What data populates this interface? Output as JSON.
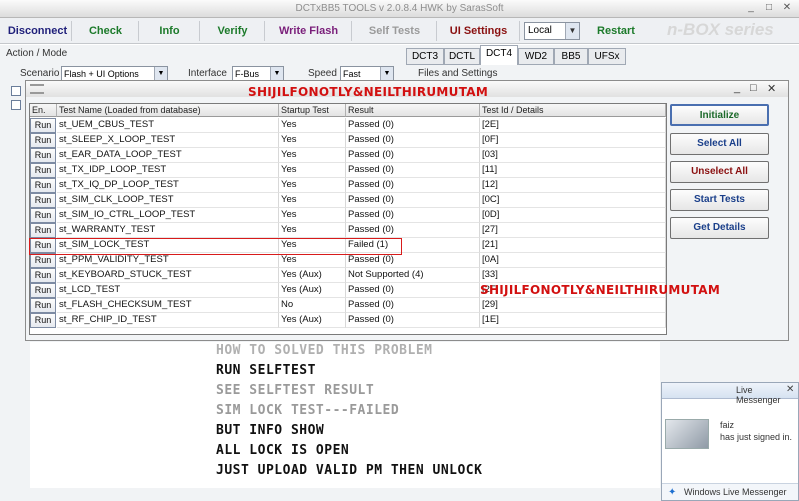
{
  "app": {
    "title": "DCTxBB5 TOOLS v 2.0.8.4 HWK by SarasSoft",
    "brand": "n-BOX series"
  },
  "toolbar": {
    "buttons": [
      {
        "label": "Disconnect",
        "color": "#1f1f7a"
      },
      {
        "label": "Check",
        "color": "#1c7a2a"
      },
      {
        "label": "Info",
        "color": "#1c7a2a"
      },
      {
        "label": "Verify",
        "color": "#1c7a2a"
      },
      {
        "label": "Write Flash",
        "color": "#7a1f7a"
      },
      {
        "label": "Self Tests",
        "color": "#9a9a9a"
      },
      {
        "label": "UI Settings",
        "color": "#8a1010"
      }
    ],
    "local_select": "Local",
    "restart_label": "Restart"
  },
  "action": {
    "group_label": "Action / Mode",
    "scenario_label": "Scenario",
    "scenario_value": "Flash + UI Options",
    "interface_label": "Interface",
    "interface_value": "F-Bus",
    "speed_label": "Speed",
    "speed_value": "Fast",
    "files_label": "Files and Settings"
  },
  "tabs": [
    "DCT3",
    "DCTL",
    "DCT4",
    "WD2",
    "BB5",
    "UFSx"
  ],
  "grid": {
    "headers": [
      "En.",
      "Test Name (Loaded from database)",
      "Startup Test",
      "Result",
      "Test Id / Details"
    ],
    "run_label": "Run",
    "rows": [
      {
        "name": "st_UEM_CBUS_TEST",
        "startup": "Yes",
        "result": "Passed (0)",
        "id": "[2E]"
      },
      {
        "name": "st_SLEEP_X_LOOP_TEST",
        "startup": "Yes",
        "result": "Passed (0)",
        "id": "[0F]"
      },
      {
        "name": "st_EAR_DATA_LOOP_TEST",
        "startup": "Yes",
        "result": "Passed (0)",
        "id": "[03]"
      },
      {
        "name": "st_TX_IDP_LOOP_TEST",
        "startup": "Yes",
        "result": "Passed (0)",
        "id": "[11]"
      },
      {
        "name": "st_TX_IQ_DP_LOOP_TEST",
        "startup": "Yes",
        "result": "Passed (0)",
        "id": "[12]"
      },
      {
        "name": "st_SIM_CLK_LOOP_TEST",
        "startup": "Yes",
        "result": "Passed (0)",
        "id": "[0C]"
      },
      {
        "name": "st_SIM_IO_CTRL_LOOP_TEST",
        "startup": "Yes",
        "result": "Passed (0)",
        "id": "[0D]"
      },
      {
        "name": "st_WARRANTY_TEST",
        "startup": "Yes",
        "result": "Passed (0)",
        "id": "[27]"
      },
      {
        "name": "st_SIM_LOCK_TEST",
        "startup": "Yes",
        "result": "Failed (1)",
        "id": "[21]"
      },
      {
        "name": "st_PPM_VALIDITY_TEST",
        "startup": "Yes",
        "result": "Passed (0)",
        "id": "[0A]"
      },
      {
        "name": "st_KEYBOARD_STUCK_TEST",
        "startup": "Yes (Aux)",
        "result": "Not Supported (4)",
        "id": "[33]"
      },
      {
        "name": "st_LCD_TEST",
        "startup": "Yes (Aux)",
        "result": "Passed (0)",
        "id": "[2F]"
      },
      {
        "name": "st_FLASH_CHECKSUM_TEST",
        "startup": "No",
        "result": "Passed (0)",
        "id": "[29]"
      },
      {
        "name": "st_RF_CHIP_ID_TEST",
        "startup": "Yes (Aux)",
        "result": "Passed (0)",
        "id": "[1E]"
      }
    ]
  },
  "side_buttons": [
    "Initialize",
    "Select All",
    "Unselect All",
    "Start Tests",
    "Get Details"
  ],
  "watermark": "SHIJILFONOTLY&NEILTHIRUMUTAM",
  "instructions": [
    {
      "text": "HOW TO SOLVED THIS PROBLEM",
      "color": "#b0b0b0"
    },
    {
      "text": "RUN SELFTEST",
      "color": "#111111"
    },
    {
      "text": "SEE  SELFTEST RESULT",
      "color": "#9a9a9a"
    },
    {
      "text": "SIM LOCK TEST---FAILED",
      "color": "#9a9a9a"
    },
    {
      "text": "BUT INFO SHOW",
      "color": "#111111"
    },
    {
      "text": "ALL LOCK IS OPEN",
      "color": "#111111"
    },
    {
      "text": "JUST UPLOAD VALID PM THEN UNLOCK",
      "color": "#111111"
    }
  ],
  "messenger": {
    "header": "Live Messenger",
    "contact": "faiz",
    "status": "has just signed in.",
    "footer": "Windows Live Messenger"
  }
}
